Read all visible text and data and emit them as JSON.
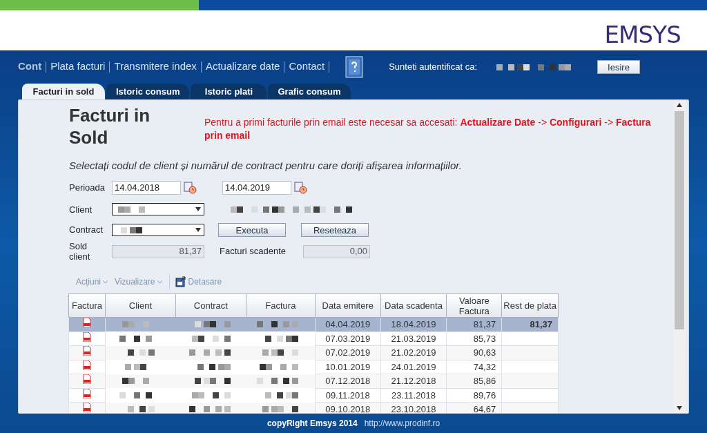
{
  "logo": "EMSYS",
  "nav": {
    "items": [
      {
        "label": "Cont",
        "selected": true
      },
      {
        "label": "Plata facturi",
        "selected": false
      },
      {
        "label": "Transmitere index",
        "selected": false
      },
      {
        "label": "Actualizare date",
        "selected": false
      },
      {
        "label": "Contact",
        "selected": false
      }
    ],
    "auth_label": "Sunteti autentificat ca:",
    "logout": "Iesire"
  },
  "tabs": [
    {
      "label": "Facturi in sold",
      "selected": true
    },
    {
      "label": "Istoric consum",
      "selected": false
    },
    {
      "label": "Istoric plati",
      "selected": false
    },
    {
      "label": "Grafic consum",
      "selected": false
    }
  ],
  "page": {
    "title": "Facturi in Sold",
    "notice": "Pentru a primi facturile prin email este necesar sa accesati: **Actualizare Date** -> **Configurari** -> **Factura prin email**",
    "instruction": "Selectați codul de client și numărul de contract pentru care doriți afișarea informațiilor."
  },
  "form": {
    "period_label": "Perioada",
    "date_from": "14.04.2018",
    "date_to": "14.04.2019",
    "client_label": "Client",
    "contract_label": "Contract",
    "execute": "Executa",
    "reset": "Reseteaza",
    "balance_label": "Sold client",
    "balance": "81,37",
    "overdue_label": "Facturi scadente",
    "overdue": "0,00"
  },
  "toolbar": [
    {
      "label": "Acțiuni",
      "kind": "menu",
      "disabled": true
    },
    {
      "label": "Vizualizare",
      "kind": "menu",
      "disabled": true
    },
    {
      "label": "Detasare",
      "kind": "detach",
      "disabled": true
    }
  ],
  "table": {
    "columns": [
      "Factura",
      "Client",
      "Contract",
      "Factura",
      "Data emitere",
      "Data scadenta",
      "Valoare Factura",
      "Rest de plata"
    ],
    "rows": [
      {
        "issued": "04.04.2019",
        "due": "18.04.2019",
        "value": "81,37",
        "remaining": "81,37",
        "selected": true
      },
      {
        "issued": "07.03.2019",
        "due": "21.03.2019",
        "value": "85,73",
        "selected": false
      },
      {
        "issued": "07.02.2019",
        "due": "21.02.2019",
        "value": "90,63",
        "selected": false
      },
      {
        "issued": "10.01.2019",
        "due": "24.01.2019",
        "value": "74,32",
        "selected": false
      },
      {
        "issued": "07.12.2018",
        "due": "21.12.2018",
        "value": "85,86",
        "selected": false
      },
      {
        "issued": "09.11.2018",
        "due": "23.11.2018",
        "value": "89,76",
        "selected": false
      },
      {
        "issued": "09.10.2018",
        "due": "23.10.2018",
        "value": "64,67",
        "selected": false
      }
    ]
  },
  "footer": {
    "copyright": "copyRight Emsys 2014",
    "link": "http://www.prodinf.ro"
  }
}
